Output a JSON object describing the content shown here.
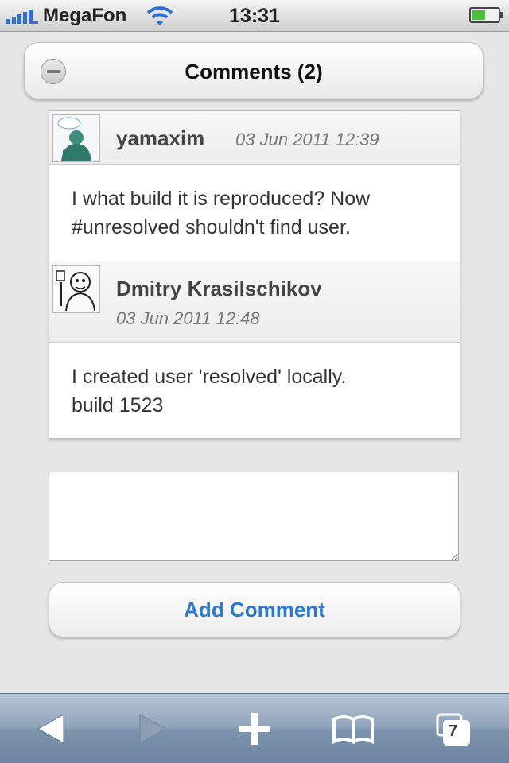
{
  "status_bar": {
    "carrier": "MegaFon",
    "time": "13:31"
  },
  "header": {
    "title": "Comments (2)"
  },
  "comments": [
    {
      "author": "yamaxim",
      "date": "03 Jun 2011 12:39",
      "text_line1": "I what build it is reproduced? Now",
      "text_line2": "#unresolved shouldn't find user."
    },
    {
      "author": "Dmitry Krasilschikov",
      "date": "03 Jun 2011 12:48",
      "text_line1": "I created user 'resolved' locally.",
      "text_line2": "build 1523"
    }
  ],
  "comment_input": {
    "value": ""
  },
  "add_button": {
    "label": "Add Comment"
  },
  "toolbar": {
    "tab_count": "7"
  },
  "colors": {
    "accent": "#2a7ad2",
    "toolbar": "#8fa3ba",
    "background": "#e6e6e6"
  },
  "icons": [
    "signal-icon",
    "wifi-icon",
    "battery-icon",
    "collapse-icon",
    "back-icon",
    "forward-icon",
    "add-bookmark-icon",
    "bookmarks-icon",
    "tabs-icon"
  ]
}
